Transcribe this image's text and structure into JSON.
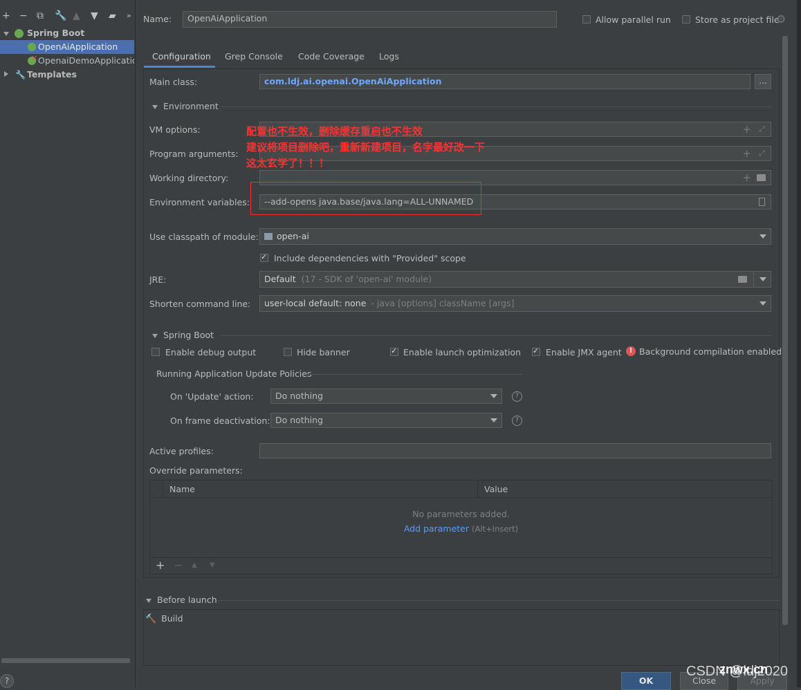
{
  "sidebar": {
    "toolbar_icons": [
      "add-icon",
      "remove-icon",
      "copy-icon",
      "wrench-icon",
      "move-up-icon",
      "move-down-icon",
      "folder-add-icon",
      "more-icon"
    ],
    "tree": [
      {
        "label": "Spring Boot",
        "kind": "group"
      },
      {
        "label": "OpenAiApplication",
        "kind": "item",
        "selected": true
      },
      {
        "label": "OpenaiDemoApplication",
        "kind": "item",
        "error": true
      },
      {
        "label": "Templates",
        "kind": "templates"
      }
    ]
  },
  "header": {
    "name_label": "Name:",
    "name_value": "OpenAiApplication",
    "allow_parallel": "Allow parallel run",
    "store_project": "Store as project file"
  },
  "tabs": [
    "Configuration",
    "Grep Console",
    "Code Coverage",
    "Logs"
  ],
  "config": {
    "main_class_label": "Main class:",
    "main_class_value": "com.ldj.ai.openai.OpenAiApplication",
    "browse_btn": "...",
    "environment_section": "Environment",
    "vm_options_label": "VM options:",
    "program_args_label": "Program arguments:",
    "working_dir_label": "Working directory:",
    "env_vars_label": "Environment variables:",
    "env_vars_value": "--add-opens java.base/java.lang=ALL-UNNAMED",
    "classpath_label": "Use classpath of module:",
    "classpath_value": "open-ai",
    "include_deps": "Include dependencies with \"Provided\" scope",
    "jre_label": "JRE:",
    "jre_value": "Default",
    "jre_hint": "(17 - SDK of 'open-ai' module)",
    "shorten_label": "Shorten command line:",
    "shorten_value": "user-local default: none",
    "shorten_hint": "- java [options] className [args]"
  },
  "annotation": {
    "line1": "配置也不生效，删除缓存重启也不生效",
    "line2": "建议将项目删除吧，重新新建项目，名字最好改一下",
    "line3": "这太玄学了！！！",
    "color": "#ff2a2a"
  },
  "spring_boot": {
    "section": "Spring Boot",
    "debug_output": "Enable debug output",
    "hide_banner": "Hide banner",
    "launch_opt": "Enable launch optimization",
    "jmx_agent": "Enable JMX agent",
    "bg_compilation": "Background compilation enabled",
    "policies_title": "Running Application Update Policies",
    "update_action_label": "On 'Update' action:",
    "update_action_value": "Do nothing",
    "frame_deact_label": "On frame deactivation:",
    "frame_deact_value": "Do nothing",
    "active_profiles_label": "Active profiles:",
    "override_label": "Override parameters:",
    "col_name": "Name",
    "col_value": "Value",
    "empty_text": "No parameters added.",
    "add_param_link": "Add parameter",
    "add_param_shortcut": "(Alt+Insert)"
  },
  "before_launch": {
    "section": "Before launch",
    "build_item": "Build"
  },
  "footer": {
    "ok": "OK",
    "close": "Close",
    "apply": "Apply",
    "help": "?",
    "watermark": "CSDN @ldj2020",
    "watermark2": "znwx.cn"
  },
  "colors": {
    "accent": "#4b6eaf",
    "link": "#589df6",
    "main_class": "#6fa7ff",
    "error": "#e05555"
  }
}
